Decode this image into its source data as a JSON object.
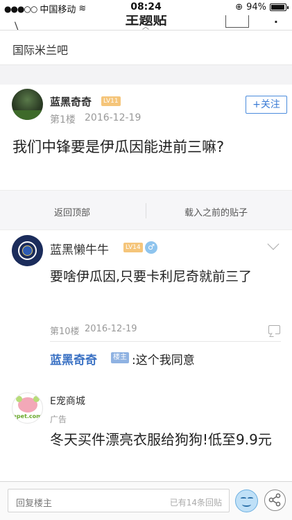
{
  "status_bar": {
    "carrier": "中国移动",
    "time": "08:24",
    "battery": "94%"
  },
  "nav": {
    "title": "主题贴"
  },
  "forum": {
    "name": "国际米兰吧"
  },
  "main_post": {
    "author": "蓝黑奇奇",
    "level": "LV11",
    "floor": "第1楼",
    "date": "2016-12-19",
    "follow_label": "+关注",
    "title": "我们中锋要是伊瓜因能进前三嘛?"
  },
  "actions": {
    "back_to_top": "返回顶部",
    "load_previous": "载入之前的贴子"
  },
  "reply": {
    "author": "蓝黑懒牛牛",
    "level": "LV14",
    "gender": "♂",
    "content": "要啥伊瓜因,只要卡利尼奇就前三了",
    "floor": "第10楼",
    "date": "2016-12-19",
    "sub_reply": {
      "author": "蓝黑奇奇",
      "badge": "楼主",
      "text": ":这个我同意"
    }
  },
  "ad": {
    "name": "E宠商城",
    "avatar_label": "epet.com",
    "tag": "广告",
    "title": "冬天买件漂亮衣服给狗狗!低至9.9元"
  },
  "bottom_bar": {
    "reply_placeholder": "回复楼主",
    "reply_count": "已有14条回贴"
  },
  "colors": {
    "accent_blue": "#3a7bd5",
    "level_badge": "#f5c57a",
    "owner_badge": "#8fb2e2"
  }
}
